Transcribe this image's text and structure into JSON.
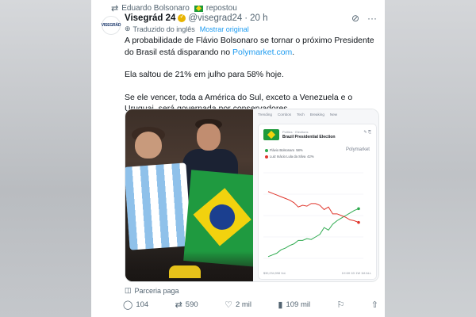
{
  "repost": {
    "user": "Eduardo Bolsonaro",
    "action": "repostou"
  },
  "tweet": {
    "author_name": "Visegrád 24",
    "handle": "@visegrad24",
    "separator": "·",
    "time": "20 h",
    "translated_label": "Traduzido do inglês",
    "show_original": "Mostrar original",
    "paragraph1_pre": "A probabilidade de Flávio Bolsonaro se tornar o próximo Presidente do Brasil está disparando no ",
    "paragraph1_link": "Polymarket.com",
    "paragraph1_post": ".",
    "paragraph2": "Ela saltou de 21% em julho para 58% hoje.",
    "paragraph3": "Se ele vencer, toda a América do Sul, exceto a Venezuela e o Uruguai, será governada por conservadores."
  },
  "avatar_text": "VISEGRÁD",
  "polymarket": {
    "nav": [
      "Trending",
      "Combos",
      "Tech",
      "Breaking",
      "New"
    ],
    "category": "Politics · Elections",
    "title": "Brazil Presidential Election",
    "legend": [
      {
        "label": "Flávio Bolsonaro",
        "value": "58%",
        "color": "#2eaa4f"
      },
      {
        "label": "Luiz Inácio Lula da Silva",
        "value": "42%",
        "color": "#e0362c"
      }
    ],
    "logo": "Polymarket",
    "footer_left": "$30,234,998 Vol.",
    "footer_right": "1H 6H 1D 1W 1M ALL"
  },
  "chart_data": {
    "type": "line",
    "title": "Brazil Presidential Election",
    "series": [
      {
        "name": "Flávio Bolsonaro",
        "color": "#2eaa4f",
        "values": [
          2,
          4,
          6,
          10,
          12,
          15,
          17,
          21,
          21,
          23,
          22,
          25,
          28,
          36,
          33,
          40,
          44,
          47,
          50,
          53,
          56,
          58
        ]
      },
      {
        "name": "Luiz Inácio Lula da Silva",
        "color": "#e0362c",
        "values": [
          78,
          76,
          74,
          72,
          70,
          68,
          65,
          60,
          62,
          61,
          64,
          64,
          62,
          57,
          60,
          52,
          52,
          50,
          48,
          45,
          44,
          42
        ]
      }
    ],
    "ylim": [
      0,
      100
    ]
  },
  "sponsor": "Parceria paga",
  "actions": {
    "replies": "104",
    "reposts": "590",
    "likes": "2 mil",
    "views": "109 mil"
  }
}
